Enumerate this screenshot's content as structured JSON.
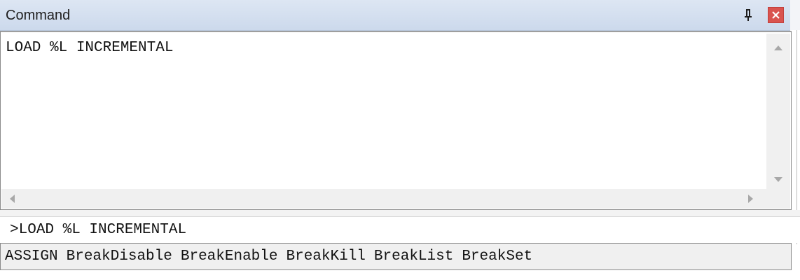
{
  "window": {
    "title": "Command",
    "colors": {
      "titlebar": "#ccd9ec",
      "close_button": "#d9534f"
    }
  },
  "title_buttons": {
    "pin_icon": "pin-icon",
    "close_icon": "close-icon"
  },
  "output": {
    "lines": [
      "LOAD %L INCREMENTAL"
    ]
  },
  "input": {
    "prompt": ">",
    "value": "LOAD %L INCREMENTAL"
  },
  "commands": [
    "ASSIGN",
    "BreakDisable",
    "BreakEnable",
    "BreakKill",
    "BreakList",
    "BreakSet"
  ]
}
